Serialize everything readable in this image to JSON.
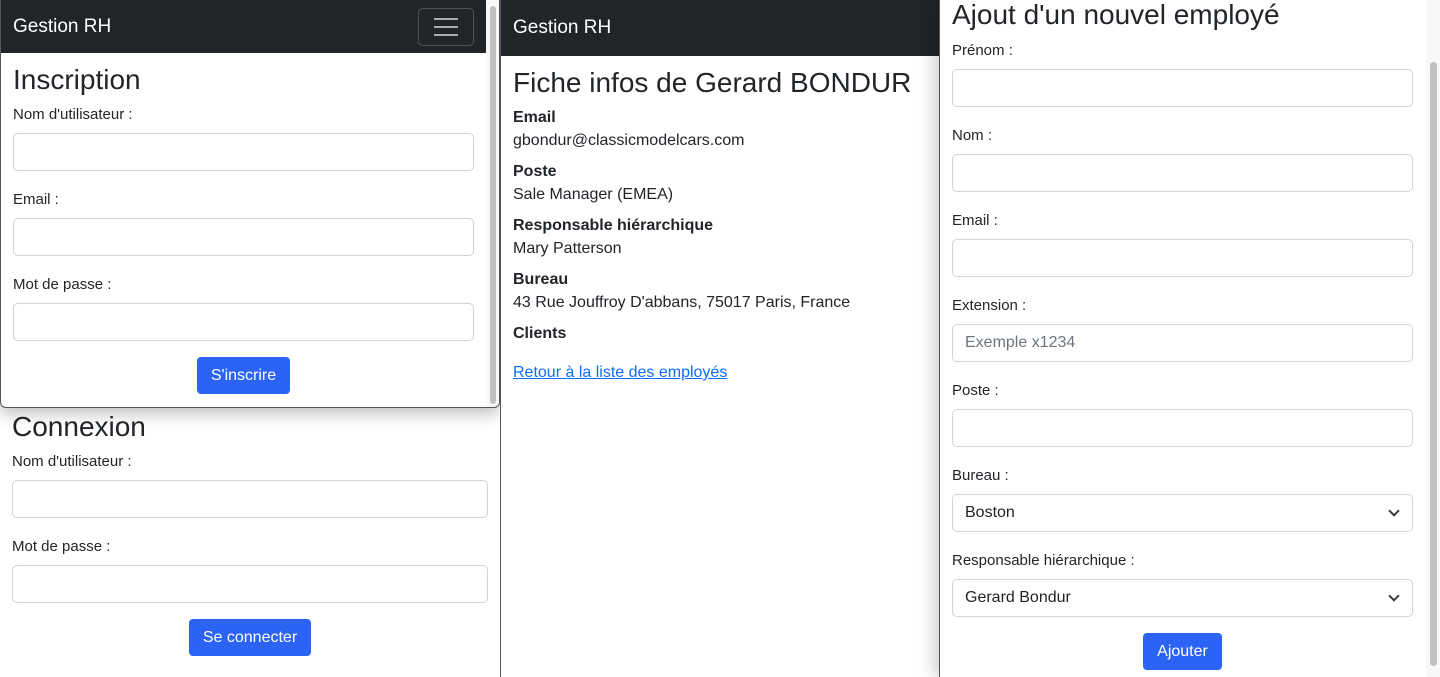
{
  "brand": "Gestion RH",
  "inscription": {
    "title": "Inscription",
    "username_label": "Nom d'utilisateur :",
    "email_label": "Email :",
    "password_label": "Mot de passe :",
    "submit": "S'inscrire"
  },
  "connexion": {
    "title": "Connexion",
    "username_label": "Nom d'utilisateur :",
    "password_label": "Mot de passe :",
    "submit": "Se connecter"
  },
  "fiche": {
    "title": "Fiche infos de Gerard BONDUR",
    "email_label": "Email",
    "email_value": "gbondur@classicmodelcars.com",
    "poste_label": "Poste",
    "poste_value": "Sale Manager (EMEA)",
    "manager_label": "Responsable hiérarchique",
    "manager_value": "Mary Patterson",
    "bureau_label": "Bureau",
    "bureau_value": "43 Rue Jouffroy D'abbans, 75017 Paris, France",
    "clients_label": "Clients",
    "back_link": "Retour à la liste des employés"
  },
  "ajout": {
    "title": "Ajout d'un nouvel employé",
    "prenom_label": "Prénom :",
    "nom_label": "Nom :",
    "email_label": "Email :",
    "extension_label": "Extension :",
    "extension_placeholder": "Exemple x1234",
    "poste_label": "Poste :",
    "bureau_label": "Bureau :",
    "bureau_selected": "Boston",
    "manager_label": "Responsable hiérarchique :",
    "manager_selected": "Gerard Bondur",
    "submit": "Ajouter"
  },
  "colors": {
    "navbar": "#212529",
    "primary": "#2b64f5",
    "link": "#0d6efd"
  }
}
